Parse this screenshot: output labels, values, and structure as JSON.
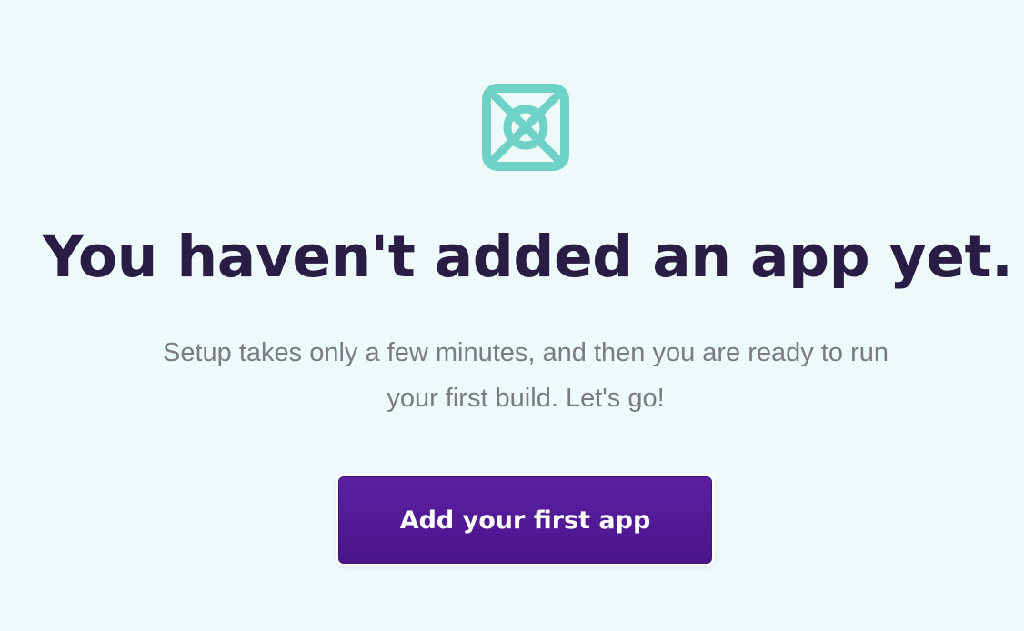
{
  "empty_state": {
    "icon": "app-placeholder-icon",
    "headline": "You haven't added an app yet.",
    "description": "Setup takes only a few minutes, and then you are ready to run your first build. Let's go!",
    "cta_label": "Add your first app"
  },
  "colors": {
    "background": "#eef9f9",
    "icon": "#6ed3c6",
    "headline": "#2a1d45",
    "description": "#7a7c80",
    "button": "#5c1fa3",
    "button_text": "#ffffff"
  }
}
